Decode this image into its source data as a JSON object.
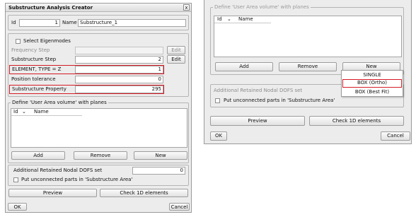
{
  "left": {
    "title": "Substructure Analysis Creator",
    "close_glyph": "x",
    "id_label": "Id",
    "id_value": "1",
    "name_label": "Name",
    "name_value": "Substructure_1",
    "eigen_label": "Select Eigenmodes",
    "freq_label": "Frequency Step",
    "freq_edit": "Edit",
    "sub_step_label": "Substructure Step",
    "sub_step_value": "2",
    "sub_step_edit": "Edit",
    "element_label": "ELEMENT, TYPE = Z",
    "element_value": "1",
    "pos_tol_label": "Position tolerance",
    "pos_tol_value": "0",
    "sub_prop_label": "Substructure Property",
    "sub_prop_value": "295",
    "group_title": "Define 'User Area volume' with planes",
    "col_id": "Id",
    "col_name": "Name",
    "add": "Add",
    "remove": "Remove",
    "new": "New",
    "dofs_label": "Additional Retained Nodal DOFS set",
    "dofs_value": "0",
    "unconnected_label": "Put unconnected parts in 'Substructure Area'",
    "preview": "Preview",
    "check1d": "Check 1D elements",
    "ok": "OK",
    "cancel": "Cancel"
  },
  "right": {
    "group_title": "Define 'User Area volume' with planes",
    "col_id": "Id",
    "col_name": "Name",
    "add": "Add",
    "remove": "Remove",
    "new": "New",
    "menu": [
      "SINGLE",
      "BOX (Ortho)",
      "BOX (Best Fit)"
    ],
    "dofs_label": "Additional Retained Nodal DOFS set",
    "dofs_value": "0",
    "unconnected_label": "Put unconnected parts in 'Substructure Area'",
    "preview": "Preview",
    "check1d": "Check 1D elements",
    "ok": "OK",
    "cancel": "Cancel"
  },
  "colors": {
    "highlight": "#d51a25",
    "dialog_bg": "#ececec"
  }
}
